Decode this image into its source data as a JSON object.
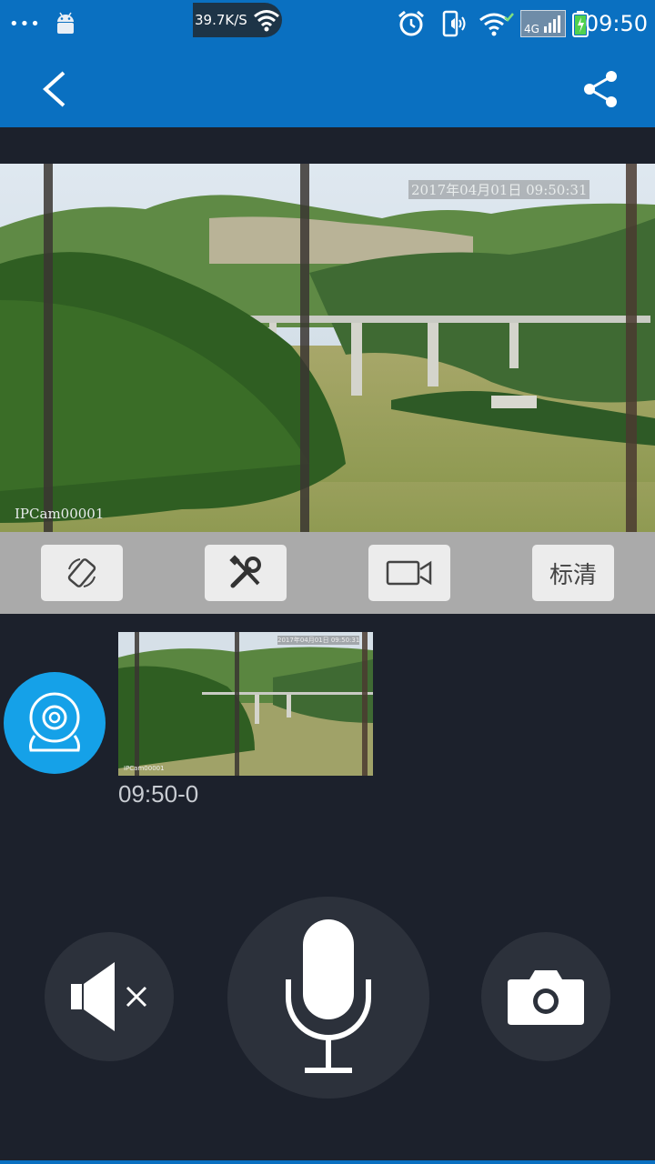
{
  "status_bar": {
    "dots": "•••",
    "net_speed": "39.7K/S",
    "network_type": "4G",
    "time": "09:50",
    "icons": [
      "android-icon",
      "wifi-icon",
      "alarm-icon",
      "phone-vibrate-icon",
      "wifi-icon",
      "signal-icon",
      "battery-icon"
    ]
  },
  "app_bar": {
    "back_icon": "back-chevron-icon",
    "share_icon": "share-icon"
  },
  "video": {
    "timestamp_overlay": "2017年04月01日  09:50:31",
    "camera_label": "IPCam00001"
  },
  "toolbar": {
    "buttons": [
      {
        "name": "rotate-button",
        "icon": "rotate-icon"
      },
      {
        "name": "settings-button",
        "icon": "tools-icon"
      },
      {
        "name": "record-video-button",
        "icon": "video-camera-icon"
      },
      {
        "name": "quality-button",
        "label": "标清"
      }
    ]
  },
  "recordings": [
    {
      "label": "09:50-0",
      "thumb_timestamp": "2017年04月01日  09:50:31",
      "thumb_cam": "IPCam00001"
    }
  ],
  "controls": {
    "mute_icon": "speaker-mute-icon",
    "mic_icon": "microphone-icon",
    "snapshot_icon": "camera-icon"
  },
  "colors": {
    "primary": "#0a70c1",
    "background": "#1c212c",
    "toolbar": "#aaaaaa",
    "avatar": "#15a1e8"
  }
}
